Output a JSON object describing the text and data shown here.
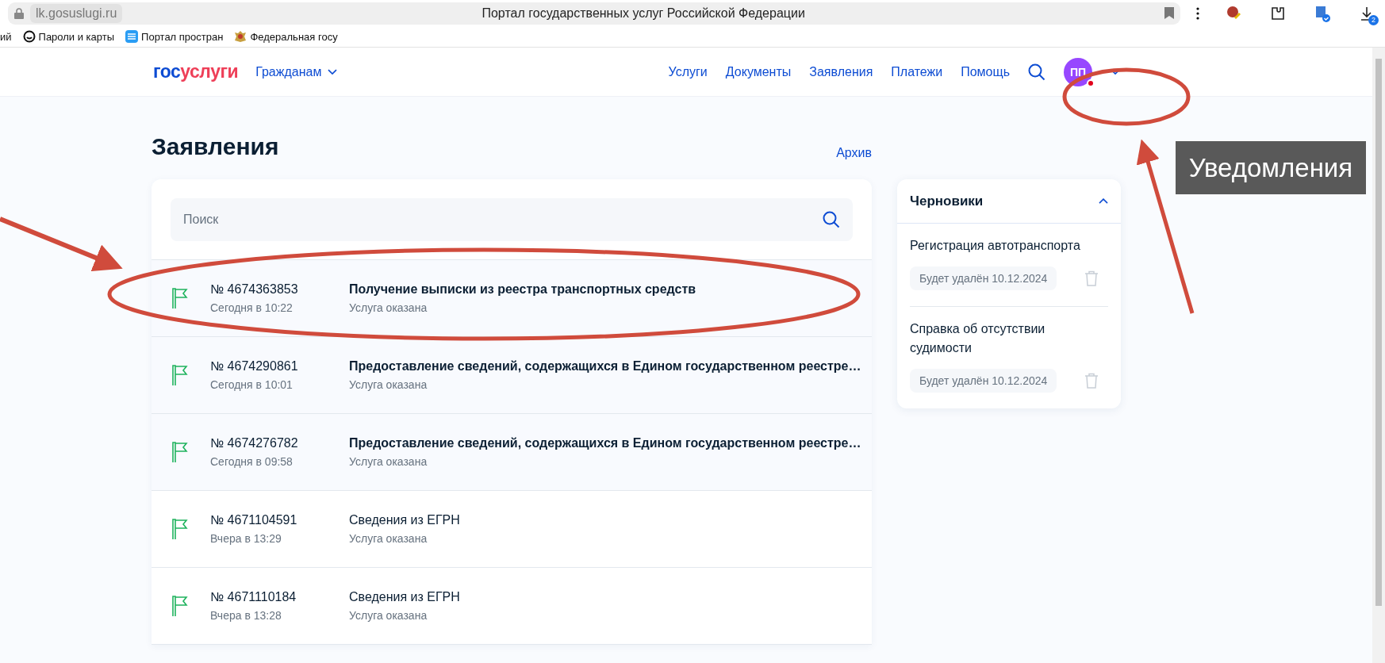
{
  "browser": {
    "url": "lk.gosuslugi.ru",
    "title": "Портал государственных услуг Российской Федерации",
    "downloads_badge": "2",
    "bookmarks": [
      {
        "label": "ий",
        "kind": "plain"
      },
      {
        "label": "Пароли и карты",
        "kind": "passwords"
      },
      {
        "label": "Портал простран",
        "kind": "wave"
      },
      {
        "label": "Федеральная госу",
        "kind": "emblem"
      }
    ]
  },
  "header": {
    "logo": [
      "гос",
      "услуги"
    ],
    "audience_menu": "Гражданам",
    "nav": [
      {
        "label": "Услуги",
        "selected": false
      },
      {
        "label": "Документы",
        "selected": false
      },
      {
        "label": "Заявления",
        "selected": false
      },
      {
        "label": "Платежи",
        "selected": false
      },
      {
        "label": "Помощь",
        "selected": false
      }
    ],
    "avatar": {
      "initials": "ПП",
      "has_notification": true
    }
  },
  "page_title": "Заявления",
  "archive_link": "Архив",
  "search": {
    "placeholder": "Поиск"
  },
  "applications": [
    {
      "number": "№ 4674363853",
      "date": "Сегодня в 10:22",
      "title": "Получение выписки из реестра транспортных средств",
      "status": "Услуга оказана",
      "unread": true
    },
    {
      "number": "№ 4674290861",
      "date": "Сегодня в 10:01",
      "title": "Предоставление сведений, содержащихся в Едином государственном реестре…",
      "status": "Услуга оказана",
      "unread": true
    },
    {
      "number": "№ 4674276782",
      "date": "Сегодня в 09:58",
      "title": "Предоставление сведений, содержащихся в Едином государственном реестре…",
      "status": "Услуга оказана",
      "unread": true
    },
    {
      "number": "№ 4671104591",
      "date": "Вчера в 13:29",
      "title": "Сведения из ЕГРН",
      "status": "Услуга оказана",
      "unread": false
    },
    {
      "number": "№ 4671110184",
      "date": "Вчера в 13:28",
      "title": "Сведения из ЕГРН",
      "status": "Услуга оказана",
      "unread": false
    }
  ],
  "drafts": {
    "title": "Черновики",
    "expanded": true,
    "items": [
      {
        "name": "Регистрация автотранспорта",
        "deletion_note": "Будет удалён 10.12.2024"
      },
      {
        "name": "Справка об отсутствии судимости",
        "deletion_note": "Будет удалён 10.12.2024"
      }
    ]
  },
  "annotations": {
    "callout": "Уведомления"
  }
}
